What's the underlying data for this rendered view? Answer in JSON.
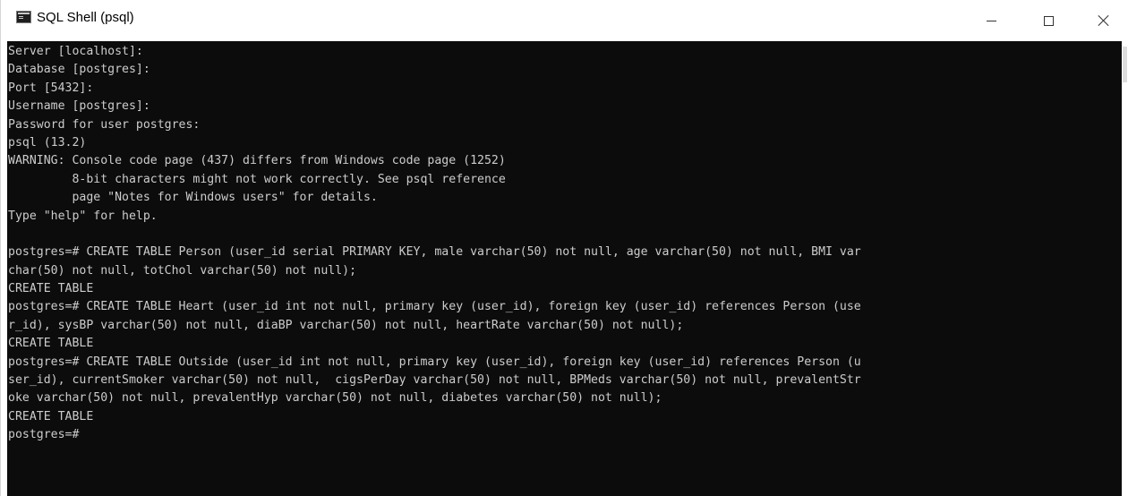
{
  "window": {
    "title": "SQL Shell (psql)",
    "minimize_icon": "minimize-icon",
    "maximize_icon": "maximize-icon",
    "close_icon": "close-icon"
  },
  "console": {
    "lines": [
      "Server [localhost]:",
      "Database [postgres]:",
      "Port [5432]:",
      "Username [postgres]:",
      "Password for user postgres:",
      "psql (13.2)",
      "WARNING: Console code page (437) differs from Windows code page (1252)",
      "         8-bit characters might not work correctly. See psql reference",
      "         page \"Notes for Windows users\" for details.",
      "Type \"help\" for help.",
      "",
      "postgres=# CREATE TABLE Person (user_id serial PRIMARY KEY, male varchar(50) not null, age varchar(50) not null, BMI var",
      "char(50) not null, totChol varchar(50) not null);",
      "CREATE TABLE",
      "postgres=# CREATE TABLE Heart (user_id int not null, primary key (user_id), foreign key (user_id) references Person (use",
      "r_id), sysBP varchar(50) not null, diaBP varchar(50) not null, heartRate varchar(50) not null);",
      "CREATE TABLE",
      "postgres=# CREATE TABLE Outside (user_id int not null, primary key (user_id), foreign key (user_id) references Person (u",
      "ser_id), currentSmoker varchar(50) not null,  cigsPerDay varchar(50) not null, BPMeds varchar(50) not null, prevalentStr",
      "oke varchar(50) not null, prevalentHyp varchar(50) not null, diabetes varchar(50) not null);",
      "CREATE TABLE",
      "postgres=#"
    ]
  }
}
